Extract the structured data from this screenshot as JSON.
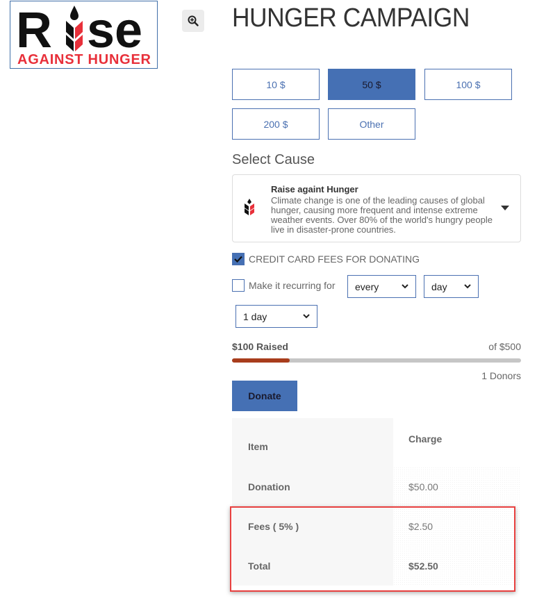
{
  "logo": {
    "word": "Rise",
    "tagline": "AGAINST HUNGER",
    "colors": {
      "black": "#111111",
      "red": "#e8303a"
    }
  },
  "zoom_icon": "zoom-in-icon",
  "title": "HUNGER CAMPAIGN",
  "amounts": [
    {
      "label": "10 $",
      "selected": false
    },
    {
      "label": "50 $",
      "selected": true
    },
    {
      "label": "100 $",
      "selected": false
    },
    {
      "label": "200 $",
      "selected": false
    },
    {
      "label": "Other",
      "selected": false
    }
  ],
  "cause": {
    "section_label": "Select Cause",
    "title": "Raise againt Hunger",
    "description": "Climate change is one of the leading causes of global hunger, causing more frequent and intense extreme weather events. Over 80% of the world's hungry people live in disaster-prone countries."
  },
  "options": {
    "credit_card_fees": {
      "label": "CREDIT CARD FEES FOR DONATING",
      "checked": true
    },
    "recurring": {
      "label": "Make it recurring for",
      "checked": false
    },
    "frequency_select": "every",
    "period_select": "day",
    "duration_select": "1 day"
  },
  "progress": {
    "raised_label": "$100 Raised",
    "goal_label": "of $500",
    "fraction": 0.2,
    "donors_label": "1 Donors"
  },
  "donate_label": "Donate",
  "summary": {
    "headers": {
      "item": "Item",
      "charge": "Charge"
    },
    "rows": [
      {
        "item": "Donation",
        "charge": "$50.00"
      },
      {
        "item": "Fees ( 5% )",
        "charge": "$2.50"
      },
      {
        "item": "Total",
        "charge": "$52.50"
      }
    ]
  },
  "colors": {
    "accent": "#4570b4",
    "progress_fill": "#a83d1c",
    "highlight": "#e8403f"
  }
}
